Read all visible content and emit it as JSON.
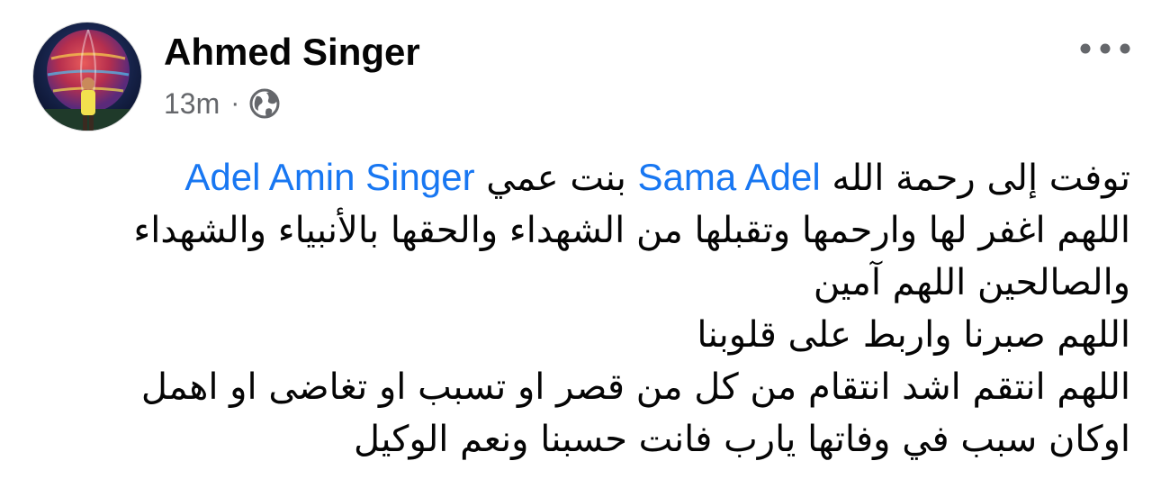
{
  "post": {
    "author": "Ahmed Singer",
    "timestamp": "13m",
    "separator": "·",
    "privacy_icon": "globe-icon",
    "more_icon": "more-options-icon",
    "body": {
      "line1_prefix": "توفت إلى رحمة الله",
      "mention1": "Sama Adel",
      "line1_middle": "بنت عمي",
      "mention2": "Adel Amin Singer",
      "line2": "اللهم اغفر لها وارحمها وتقبلها من الشهداء والحقها بالأنبياء والشهداء",
      "line3": "والصالحين اللهم آمين",
      "line4": "اللهم صبرنا واربط على قلوبنا",
      "line5": "اللهم انتقم اشد انتقام من كل من قصر او تسبب او تغاضى او اهمل",
      "line6": "اوكان سبب في وفاتها يارب فانت حسبنا ونعم الوكيل"
    }
  },
  "colors": {
    "mention": "#1877f2",
    "meta_text": "#65676b",
    "body_text": "#050505"
  }
}
